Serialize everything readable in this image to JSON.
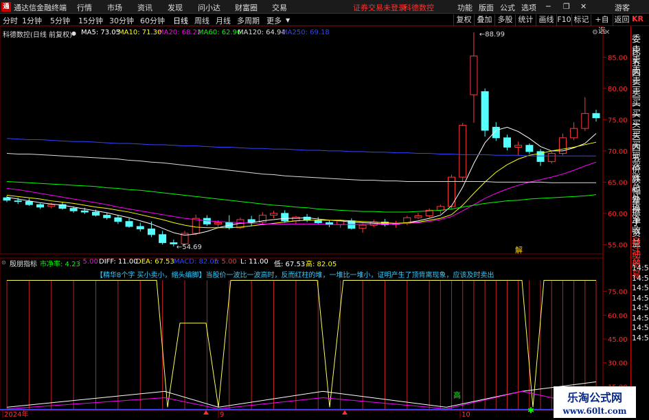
{
  "window": {
    "app_title": "通达信金融终端",
    "menu": [
      "行情",
      "市场",
      "资讯",
      "发现",
      "问小达",
      "财富圈",
      "交易"
    ],
    "warning": "证券交易未登录",
    "stock_warning": "科德数控",
    "right_menu": [
      "功能",
      "版面",
      "公式",
      "选项"
    ],
    "guest": "游客"
  },
  "toolbar": {
    "periods": [
      "分时",
      "1分钟",
      "5分钟",
      "15分钟",
      "30分钟",
      "60分钟",
      "日线",
      "周线",
      "月线",
      "多周期",
      "更多"
    ],
    "active": "日线",
    "right_buttons": [
      "复权",
      "叠加",
      "多股",
      "统计",
      "画线",
      "F10",
      "标记",
      "+自选",
      "返回"
    ],
    "corner": "KR"
  },
  "chart_header": {
    "title": "科德数控(日线 前复权)",
    "ma": [
      {
        "label": "MA5: 73.05",
        "color": "#ffffff"
      },
      {
        "label": "MA10: 71.30",
        "color": "#ffff00"
      },
      {
        "label": "MA20: 68.22",
        "color": "#ff00ff"
      },
      {
        "label": "MA60: 62.96",
        "color": "#00ff00"
      },
      {
        "label": "MA120: 64.94",
        "color": "#dddddd"
      },
      {
        "label": "MA250: 69.18",
        "color": "#3344ff"
      }
    ]
  },
  "indicator_header": {
    "name": "殷朋指标",
    "items": [
      {
        "label": "市净率: 4.23",
        "color": "#00ff00"
      },
      {
        "label": ": 5.00",
        "color": "#ff00ff"
      },
      {
        "label": "DIFF: 11.00",
        "color": "#ffffff"
      },
      {
        "label": "DEA: 67.53",
        "color": "#ffff00"
      },
      {
        "label": "MACD: 82.05",
        "color": "#3344ff"
      },
      {
        "label": "r: 5.00",
        "color": "#ff3030"
      },
      {
        "label": "L: 11.00",
        "color": "#ffffff"
      },
      {
        "label": "低: 67.53",
        "color": "#ffffff"
      },
      {
        "label": "高: 82.05",
        "color": "#ffff00"
      }
    ],
    "note": "【精华8个字 买小卖小，缩头编脚】当股价一波比一波高时，反而红柱的堆，一堆比一堆小，证明产生了顶背离现象，应该及时卖出"
  },
  "side_panel": {
    "items": [
      "委比",
      "卖五",
      "卖四",
      "卖三",
      "卖二",
      "卖一",
      "买一",
      "买二",
      "买三",
      "买四",
      "买五",
      "现价",
      "涨跌",
      "涨幅",
      "总量",
      "外盘",
      "换手",
      "净资",
      "收益",
      "自动",
      "注册",
      "交易",
      "14:5",
      "14:5",
      "14:5",
      "14:5",
      "14:5",
      "14:5",
      "14:5",
      "14:5"
    ]
  },
  "chart_data": [
    {
      "type": "candlestick",
      "title": "科德数控(日线 前复权)",
      "y_ticks": [
        55.0,
        60.0,
        65.0,
        70.0,
        75.0,
        80.0,
        85.0
      ],
      "ylim": [
        53.5,
        90
      ],
      "annotations": [
        "88.99",
        "54.69",
        "解"
      ],
      "ohlc": [
        [
          62.5,
          62.8,
          61.8,
          62.1
        ],
        [
          62.0,
          62.5,
          61.5,
          61.9
        ],
        [
          61.9,
          62.4,
          61.2,
          61.4
        ],
        [
          61.4,
          61.6,
          60.7,
          61.0
        ],
        [
          61.1,
          61.7,
          60.8,
          61.4
        ],
        [
          61.4,
          61.8,
          60.6,
          60.8
        ],
        [
          60.8,
          61.1,
          60.1,
          60.4
        ],
        [
          60.4,
          60.9,
          59.9,
          60.2
        ],
        [
          60.2,
          60.6,
          59.5,
          59.7
        ],
        [
          59.7,
          60.1,
          59.0,
          59.3
        ],
        [
          59.3,
          59.7,
          58.3,
          58.7
        ],
        [
          58.7,
          59.2,
          57.7,
          57.9
        ],
        [
          57.9,
          58.5,
          57.1,
          57.5
        ],
        [
          57.5,
          58.7,
          56.2,
          56.6
        ],
        [
          56.6,
          57.2,
          55.0,
          55.3
        ],
        [
          55.3,
          55.8,
          54.69,
          55.1
        ],
        [
          55.1,
          57.2,
          54.9,
          56.8
        ],
        [
          56.8,
          59.8,
          56.5,
          59.2
        ],
        [
          59.2,
          59.7,
          58.0,
          58.3
        ],
        [
          58.3,
          58.9,
          57.6,
          58.5
        ],
        [
          58.5,
          59.7,
          57.4,
          57.7
        ],
        [
          57.7,
          59.3,
          57.5,
          59.0
        ],
        [
          59.0,
          59.6,
          58.0,
          58.6
        ],
        [
          58.6,
          60.2,
          58.3,
          59.7
        ],
        [
          59.7,
          60.4,
          59.2,
          60.0
        ],
        [
          60.0,
          60.5,
          58.5,
          58.8
        ],
        [
          58.8,
          59.6,
          58.3,
          59.4
        ],
        [
          59.4,
          59.9,
          58.6,
          58.9
        ],
        [
          58.9,
          59.4,
          58.2,
          58.5
        ],
        [
          58.5,
          58.9,
          57.8,
          58.2
        ],
        [
          58.2,
          59.0,
          57.7,
          58.8
        ],
        [
          58.8,
          59.2,
          57.4,
          57.6
        ],
        [
          57.6,
          58.4,
          56.9,
          58.1
        ],
        [
          58.1,
          59.0,
          57.8,
          58.6
        ],
        [
          58.6,
          59.1,
          57.9,
          58.2
        ],
        [
          58.2,
          58.8,
          57.7,
          58.4
        ],
        [
          58.4,
          59.6,
          58.1,
          59.3
        ],
        [
          59.3,
          60.1,
          59.1,
          59.6
        ],
        [
          59.6,
          60.8,
          59.3,
          60.5
        ],
        [
          60.5,
          61.4,
          59.9,
          61.1
        ],
        [
          61.1,
          66.2,
          60.8,
          65.8
        ],
        [
          65.8,
          74.5,
          65.1,
          74.1
        ],
        [
          79.0,
          88.99,
          74.5,
          85.2
        ],
        [
          79.5,
          80.0,
          72.3,
          73.3
        ],
        [
          73.8,
          74.6,
          71.6,
          72.1
        ],
        [
          72.1,
          72.6,
          70.1,
          70.6
        ],
        [
          70.6,
          71.5,
          69.2,
          70.9
        ],
        [
          70.9,
          71.2,
          69.5,
          69.9
        ],
        [
          69.9,
          70.3,
          67.6,
          68.3
        ],
        [
          68.3,
          69.9,
          68.0,
          69.6
        ],
        [
          69.6,
          72.8,
          69.3,
          72.1
        ],
        [
          72.1,
          74.6,
          71.7,
          73.6
        ],
        [
          73.6,
          78.6,
          73.2,
          76.0
        ],
        [
          76.0,
          76.6,
          74.7,
          75.3
        ]
      ],
      "series": [
        {
          "name": "MA5",
          "values": [
            62.6,
            62.3,
            62.0,
            61.7,
            61.5,
            61.3,
            61.0,
            60.7,
            60.4,
            60.1,
            59.7,
            59.3,
            58.8,
            58.3,
            57.6,
            56.9,
            56.5,
            56.7,
            57.1,
            57.7,
            58.1,
            58.4,
            58.5,
            58.8,
            59.0,
            59.2,
            59.2,
            59.3,
            59.1,
            58.9,
            58.8,
            58.6,
            58.5,
            58.4,
            58.3,
            58.3,
            58.5,
            58.8,
            59.2,
            59.7,
            61.2,
            64.2,
            68.0,
            71.3,
            73.3,
            73.8,
            73.1,
            72.0,
            70.7,
            70.0,
            70.0,
            70.5,
            71.2,
            72.8
          ]
        },
        {
          "name": "MA10",
          "values": [
            62.9,
            62.7,
            62.5,
            62.3,
            62.0,
            61.8,
            61.6,
            61.3,
            61.0,
            60.8,
            60.5,
            60.2,
            59.8,
            59.4,
            59.0,
            58.5,
            58.1,
            57.8,
            57.7,
            57.7,
            57.7,
            57.8,
            58.0,
            58.2,
            58.4,
            58.6,
            58.8,
            58.9,
            58.9,
            58.9,
            58.9,
            58.8,
            58.7,
            58.6,
            58.5,
            58.4,
            58.5,
            58.6,
            58.9,
            59.2,
            59.8,
            61.3,
            63.2,
            65.0,
            66.6,
            67.8,
            68.7,
            69.3,
            69.6,
            70.0,
            70.3,
            70.6,
            71.0,
            71.4
          ]
        },
        {
          "name": "MA20",
          "values": [
            64.0,
            63.8,
            63.5,
            63.2,
            62.9,
            62.6,
            62.3,
            62.0,
            61.7,
            61.4,
            61.0,
            60.7,
            60.4,
            60.1,
            59.8,
            59.5,
            59.2,
            59.0,
            58.8,
            58.7,
            58.6,
            58.5,
            58.4,
            58.3,
            58.3,
            58.3,
            58.3,
            58.3,
            58.3,
            58.2,
            58.2,
            58.2,
            58.2,
            58.2,
            58.3,
            58.3,
            58.4,
            58.5,
            58.7,
            59.0,
            59.5,
            60.4,
            61.4,
            62.4,
            63.2,
            63.9,
            64.5,
            65.0,
            65.4,
            65.8,
            66.3,
            66.9,
            67.6,
            68.2
          ]
        },
        {
          "name": "MA60",
          "values": [
            65.1,
            65.0,
            64.9,
            64.8,
            64.7,
            64.6,
            64.5,
            64.4,
            64.3,
            64.1,
            64.0,
            63.8,
            63.7,
            63.5,
            63.3,
            63.1,
            62.9,
            62.7,
            62.5,
            62.3,
            62.1,
            61.9,
            61.7,
            61.5,
            61.3,
            61.2,
            61.0,
            60.9,
            60.7,
            60.6,
            60.5,
            60.4,
            60.3,
            60.3,
            60.2,
            60.2,
            60.2,
            60.3,
            60.4,
            60.5,
            60.7,
            61.0,
            61.3,
            61.6,
            61.8,
            62.0,
            62.1,
            62.3,
            62.4,
            62.5,
            62.6,
            62.7,
            62.8,
            63.0
          ]
        },
        {
          "name": "MA120",
          "values": [
            69.6,
            69.5,
            69.5,
            69.4,
            69.3,
            69.2,
            69.1,
            69.0,
            68.9,
            68.8,
            68.7,
            68.5,
            68.4,
            68.2,
            68.1,
            67.9,
            67.7,
            67.5,
            67.3,
            67.1,
            66.9,
            66.7,
            66.5,
            66.3,
            66.2,
            66.0,
            65.9,
            65.8,
            65.7,
            65.6,
            65.5,
            65.4,
            65.3,
            65.3,
            65.2,
            65.2,
            65.1,
            65.1,
            65.1,
            65.1,
            65.1,
            65.1,
            65.1,
            65.1,
            65.0,
            65.0,
            65.0,
            65.0,
            65.0,
            64.9,
            64.9,
            64.9,
            64.9,
            64.9
          ]
        },
        {
          "name": "MA250",
          "values": [
            72.0,
            71.9,
            71.8,
            71.8,
            71.7,
            71.6,
            71.5,
            71.5,
            71.4,
            71.3,
            71.2,
            71.2,
            71.1,
            71.0,
            71.0,
            70.9,
            70.8,
            70.8,
            70.7,
            70.6,
            70.6,
            70.5,
            70.4,
            70.4,
            70.3,
            70.3,
            70.2,
            70.1,
            70.1,
            70.0,
            70.0,
            69.9,
            69.9,
            69.8,
            69.8,
            69.7,
            69.7,
            69.6,
            69.6,
            69.5,
            69.5,
            69.4,
            69.4,
            69.4,
            69.3,
            69.3,
            69.3,
            69.2,
            69.2,
            69.2,
            69.2,
            69.2,
            69.2,
            69.2
          ]
        }
      ]
    },
    {
      "type": "line",
      "title": "殷朋指标",
      "y_ticks": [
        15.0,
        30.0,
        45.0,
        60.0,
        75.0
      ],
      "ylim": [
        0,
        90
      ],
      "x_labels": [
        "2024年",
        "9",
        "10"
      ],
      "annotations": [
        "高"
      ],
      "series": [
        {
          "name": "高",
          "values": [
            82,
            82,
            82,
            82,
            82,
            82,
            82,
            82,
            82,
            82,
            82,
            82,
            82,
            82,
            82,
            82,
            82,
            82,
            82,
            82,
            82,
            82,
            82,
            82,
            82,
            82,
            82,
            82,
            82,
            82,
            82,
            82,
            82,
            82,
            82,
            82,
            82,
            82,
            82,
            82,
            82,
            82,
            82,
            82,
            82,
            82,
            82,
            82,
            82,
            82,
            82,
            82,
            82,
            82
          ]
        }
      ]
    }
  ]
}
